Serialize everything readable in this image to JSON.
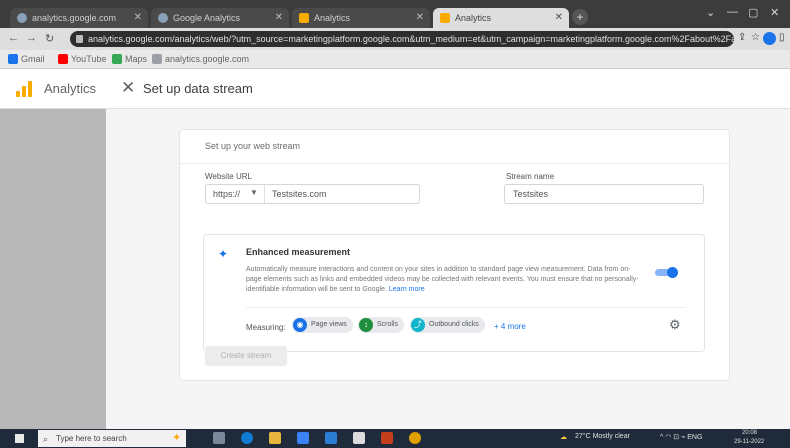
{
  "browser": {
    "tabs": [
      {
        "label": "analytics.google.com",
        "active": false
      },
      {
        "label": "Google Analytics",
        "active": false
      },
      {
        "label": "Analytics",
        "active": false
      },
      {
        "label": "Analytics",
        "active": true
      }
    ],
    "new_tab_label": "+",
    "window_controls": [
      "⌄",
      "—",
      "▢",
      "✕"
    ],
    "nav": {
      "back": "←",
      "forward": "→",
      "reload": "↻"
    },
    "url": "analytics.google.com/analytics/web/?utm_source=marketingplatform.google.com&utm_medium=et&utm_campaign=marketingplatform.google.com%2Fabout%2Fanalytics",
    "omnibox_icons": {
      "share": "⇪",
      "star": "☆",
      "extensions": "▯"
    },
    "bookmarks": [
      {
        "label": "Gmail",
        "color": "#1a73e8"
      },
      {
        "label": "YouTube",
        "color": "#ff0000"
      },
      {
        "label": "Maps",
        "color": "#34a853"
      },
      {
        "label": "analytics.google.com",
        "color": "#9aa0a6"
      }
    ]
  },
  "app": {
    "product_name": "Analytics",
    "dialog_title": "Set up data stream",
    "close_icon": "close-icon"
  },
  "form": {
    "section_title": "Set up your web stream",
    "website_url_label": "Website URL",
    "protocol_value": "https://",
    "url_value": "Testsites.com",
    "stream_name_label": "Stream name",
    "stream_name_value": "Testsites",
    "enhanced": {
      "title": "Enhanced measurement",
      "description": "Automatically measure interactions and content on your sites in addition to standard page view measurement.",
      "description2": "Data from on-page elements such as links and embedded videos may be collected with relevant events. You must ensure that no personally-identifiable information will be sent to Google.",
      "learn_more": "Learn more",
      "toggle_on": true,
      "measuring_label": "Measuring:",
      "chips": [
        {
          "label": "Page views",
          "color": "#1a73e8",
          "glyph": "◉"
        },
        {
          "label": "Scrolls",
          "color": "#1e8e3e",
          "glyph": "↕"
        },
        {
          "label": "Outbound clicks",
          "color": "#12b5cb",
          "glyph": "⤴"
        }
      ],
      "more_label": "+ 4 more"
    },
    "create_button": "Create stream"
  },
  "taskbar": {
    "search_placeholder": "Type here to search",
    "weather": "27°C  Mostly clear",
    "tray_icons": "^ ◠ ⊡ ⌁ ENG",
    "time": "20:08",
    "date": "29-11-2022"
  }
}
